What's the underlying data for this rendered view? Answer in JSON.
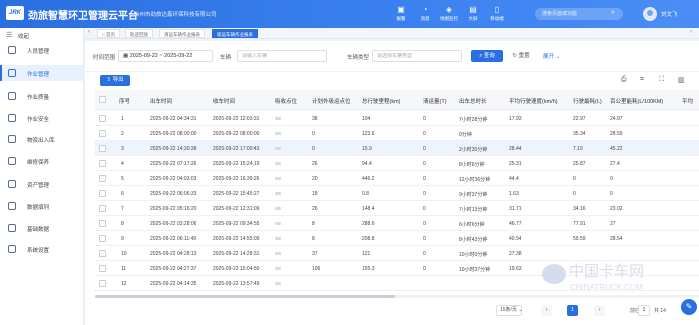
{
  "header": {
    "logo_text": "JRK",
    "app_title": "劲旅智慧环卫管理云平台",
    "org_name": "台州市劲旅达鑫环保科技有限公司",
    "tools": [
      {
        "icon": "desktop-icon",
        "glyph": "▣",
        "label": "报警"
      },
      {
        "icon": "bell-icon",
        "glyph": "◔",
        "label": "消息"
      },
      {
        "icon": "map-icon",
        "glyph": "◈",
        "label": "地图监控"
      },
      {
        "icon": "chart-icon",
        "glyph": "▤",
        "label": "大屏"
      },
      {
        "icon": "mobile-icon",
        "glyph": "▯",
        "label": "移动端"
      }
    ],
    "search_placeholder": "搜索页面或功能",
    "username": "刘文飞"
  },
  "sidebar": {
    "collapse_label": "收起",
    "items": [
      {
        "label": "人员管理",
        "icon": "person-icon"
      },
      {
        "label": "作业管理",
        "icon": "work-icon"
      },
      {
        "label": "作业质量",
        "icon": "quality-icon"
      },
      {
        "label": "作业安全",
        "icon": "shield-icon"
      },
      {
        "label": "物资出入库",
        "icon": "warehouse-icon"
      },
      {
        "label": "维修保养",
        "icon": "wrench-icon"
      },
      {
        "label": "资产管理",
        "icon": "asset-icon"
      },
      {
        "label": "数据填列",
        "icon": "data-icon"
      },
      {
        "label": "基础数据",
        "icon": "database-icon"
      },
      {
        "label": "系统设置",
        "icon": "settings-icon"
      }
    ]
  },
  "tabs": [
    {
      "label": "首页",
      "active": false
    },
    {
      "label": "轨迹回放",
      "active": false
    },
    {
      "label": "清运车辆作业报表",
      "active": false
    },
    {
      "label": "吸运车辆作业报表",
      "active": true
    }
  ],
  "filter": {
    "time_range_label": "时间范围",
    "date_start": "2025-09-22",
    "date_sep": "~",
    "date_end": "2025-09-22",
    "vehicle_label": "车辆",
    "vehicle_placeholder": "请输入车辆",
    "vehicle_type_label": "车辆类型",
    "vehicle_type_placeholder": "请选择车辆类型",
    "query_label": "查询",
    "reset_label": "重置",
    "expand_label": "展开"
  },
  "table": {
    "export_label": "导出",
    "columns": [
      "序号",
      "出车时间",
      "收车时间",
      "吸收点位",
      "计划外吸运点位",
      "总行驶里程(km)",
      "清运量(T)",
      "出车总时长",
      "平均行驶速度(km/h)",
      "行驶最耗(L)",
      "百公里能耗(L/100KM)",
      "平均"
    ],
    "rows": [
      {
        "no": "1",
        "out": "2025-09-22 04:34:31",
        "in": "2025-09-22 12:03:31",
        "points": "",
        "extra": "38",
        "mileage": "104",
        "volume": "0",
        "duration": "7小时28分钟",
        "speed": "17.93",
        "fuel": "22.97",
        "per100": "24.97"
      },
      {
        "no": "2",
        "out": "2025-09-22 08:00:00",
        "in": "2025-09-22 08:00:00",
        "points": "",
        "extra": "0",
        "mileage": "123.6",
        "volume": "0",
        "duration": "0分钟",
        "speed": "",
        "fuel": "35.34",
        "per100": "28.59"
      },
      {
        "no": "3",
        "out": "2025-09-22 14:30:38",
        "in": "2025-09-22 17:00:43",
        "points": "",
        "extra": "0",
        "mileage": "15.9",
        "volume": "0",
        "duration": "2小时30分钟",
        "speed": "28.44",
        "fuel": "7.19",
        "per100": "45.22"
      },
      {
        "no": "4",
        "out": "2025-09-22 07:17:26",
        "in": "2025-09-22 15:24:19",
        "points": "",
        "extra": "26",
        "mileage": "94.4",
        "volume": "0",
        "duration": "8小时6分钟",
        "speed": "25.31",
        "fuel": "25.87",
        "per100": "27.4"
      },
      {
        "no": "5",
        "out": "2025-09-22 04:03:03",
        "in": "2025-09-22 16:39:26",
        "points": "",
        "extra": "20",
        "mileage": "446.2",
        "volume": "0",
        "duration": "12小时36分钟",
        "speed": "44.4",
        "fuel": "0",
        "per100": "0"
      },
      {
        "no": "6",
        "out": "2025-09-22 06:06:33",
        "in": "2025-09-22 15:45:27",
        "points": "",
        "extra": "18",
        "mileage": "0.8",
        "volume": "0",
        "duration": "9小时37分钟",
        "speed": "1.63",
        "fuel": "0",
        "per100": "0"
      },
      {
        "no": "7",
        "out": "2025-09-22 05:16:20",
        "in": "2025-09-22 12:31:09",
        "points": "",
        "extra": "26",
        "mileage": "148.4",
        "volume": "0",
        "duration": "7小时13分钟",
        "speed": "31.71",
        "fuel": "34.16",
        "per100": "23.02"
      },
      {
        "no": "8",
        "out": "2025-09-22 03:28:06",
        "in": "2025-09-22 09:34:55",
        "points": "",
        "extra": "8",
        "mileage": "288.6",
        "volume": "0",
        "duration": "6小时6分钟",
        "speed": "46.77",
        "fuel": "77.91",
        "per100": "27"
      },
      {
        "no": "9",
        "out": "2025-09-22 06:11:49",
        "in": "2025-09-22 14:55:09",
        "points": "",
        "extra": "8",
        "mileage": "208.8",
        "volume": "0",
        "duration": "8小时43分钟",
        "speed": "40.54",
        "fuel": "59.59",
        "per100": "28.54"
      },
      {
        "no": "10",
        "out": "2025-09-22 04:28:13",
        "in": "2025-09-22 14:28:31",
        "points": "",
        "extra": "37",
        "mileage": "121",
        "volume": "0",
        "duration": "10小时0分钟",
        "speed": "27.38",
        "fuel": "",
        "per100": ""
      },
      {
        "no": "11",
        "out": "2025-09-22 04:27:37",
        "in": "2025-09-22 15:04:50",
        "points": "",
        "extra": "106",
        "mileage": "155.3",
        "volume": "0",
        "duration": "10小时37分钟",
        "speed": "19.63",
        "fuel": "",
        "per100": ""
      },
      {
        "no": "12",
        "out": "2025-09-22 04:14:35",
        "in": "2025-09-22 13:57:49",
        "points": "",
        "extra": "",
        "mileage": "",
        "volume": "",
        "duration": "",
        "speed": "",
        "fuel": "",
        "per100": ""
      }
    ]
  },
  "pagination": {
    "page_size": "15条/页",
    "current": "1",
    "prev_glyph": "‹",
    "next_glyph": "›",
    "goto_label": "前往",
    "goto_value": "1",
    "total_label": "共 14"
  },
  "watermark": {
    "line1": "中国卡车网",
    "line2": "CHINATRUCK.COM"
  },
  "colors": {
    "primary": "#2a6fe0",
    "header": "#3b82f0",
    "highlight_row": "#eef4fd"
  }
}
